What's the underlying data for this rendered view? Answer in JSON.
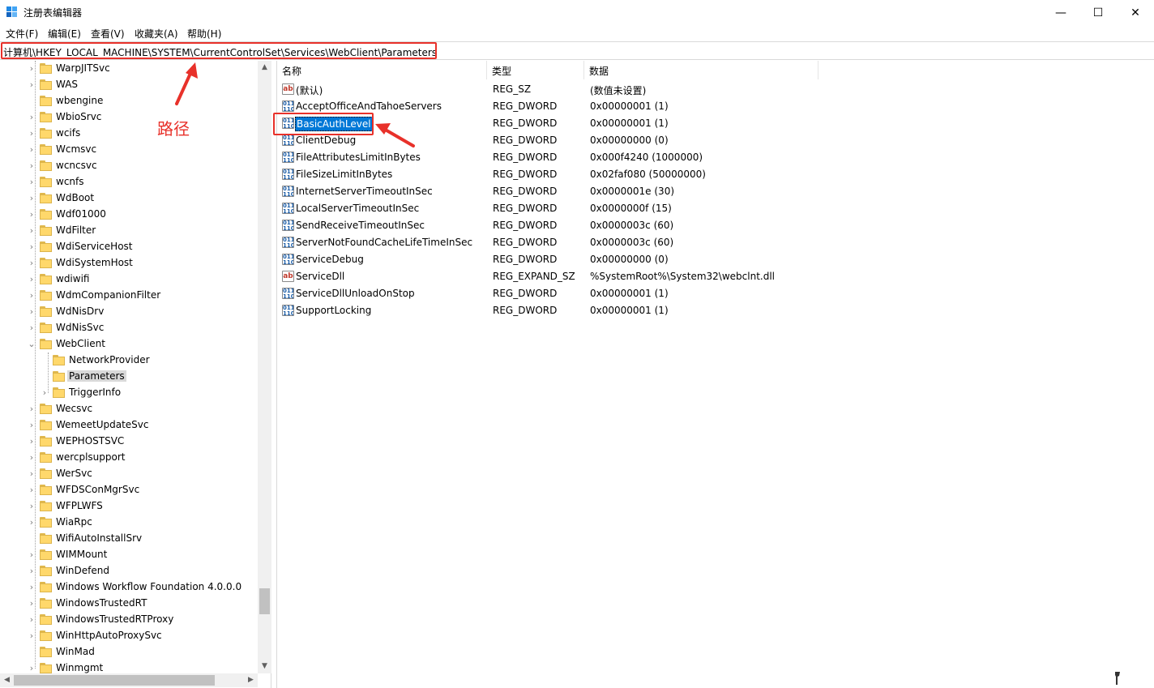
{
  "window": {
    "title": "注册表编辑器",
    "controls": {
      "minimize": "—",
      "maximize": "☐",
      "close": "✕"
    }
  },
  "menu": [
    "文件(F)",
    "编辑(E)",
    "查看(V)",
    "收藏夹(A)",
    "帮助(H)"
  ],
  "address": "计算机\\HKEY_LOCAL_MACHINE\\SYSTEM\\CurrentControlSet\\Services\\WebClient\\Parameters",
  "annotation": {
    "label": "路径"
  },
  "tree": {
    "items": [
      {
        "label": "WarpJITSvc",
        "expandable": true,
        "level": 1
      },
      {
        "label": "WAS",
        "expandable": true,
        "level": 1
      },
      {
        "label": "wbengine",
        "expandable": false,
        "level": 1
      },
      {
        "label": "WbioSrvc",
        "expandable": true,
        "level": 1
      },
      {
        "label": "wcifs",
        "expandable": true,
        "level": 1
      },
      {
        "label": "Wcmsvc",
        "expandable": true,
        "level": 1
      },
      {
        "label": "wcncsvc",
        "expandable": true,
        "level": 1
      },
      {
        "label": "wcnfs",
        "expandable": true,
        "level": 1
      },
      {
        "label": "WdBoot",
        "expandable": true,
        "level": 1
      },
      {
        "label": "Wdf01000",
        "expandable": true,
        "level": 1
      },
      {
        "label": "WdFilter",
        "expandable": true,
        "level": 1
      },
      {
        "label": "WdiServiceHost",
        "expandable": true,
        "level": 1
      },
      {
        "label": "WdiSystemHost",
        "expandable": true,
        "level": 1
      },
      {
        "label": "wdiwifi",
        "expandable": true,
        "level": 1
      },
      {
        "label": "WdmCompanionFilter",
        "expandable": true,
        "level": 1
      },
      {
        "label": "WdNisDrv",
        "expandable": true,
        "level": 1
      },
      {
        "label": "WdNisSvc",
        "expandable": true,
        "level": 1
      },
      {
        "label": "WebClient",
        "expandable": true,
        "expanded": true,
        "level": 1
      },
      {
        "label": "NetworkProvider",
        "expandable": false,
        "level": 2
      },
      {
        "label": "Parameters",
        "expandable": false,
        "level": 2,
        "selected": true
      },
      {
        "label": "TriggerInfo",
        "expandable": true,
        "level": 2
      },
      {
        "label": "Wecsvc",
        "expandable": true,
        "level": 1
      },
      {
        "label": "WemeetUpdateSvc",
        "expandable": true,
        "level": 1
      },
      {
        "label": "WEPHOSTSVC",
        "expandable": true,
        "level": 1
      },
      {
        "label": "wercplsupport",
        "expandable": true,
        "level": 1
      },
      {
        "label": "WerSvc",
        "expandable": true,
        "level": 1
      },
      {
        "label": "WFDSConMgrSvc",
        "expandable": true,
        "level": 1
      },
      {
        "label": "WFPLWFS",
        "expandable": true,
        "level": 1
      },
      {
        "label": "WiaRpc",
        "expandable": true,
        "level": 1
      },
      {
        "label": "WifiAutoInstallSrv",
        "expandable": false,
        "level": 1
      },
      {
        "label": "WIMMount",
        "expandable": true,
        "level": 1
      },
      {
        "label": "WinDefend",
        "expandable": true,
        "level": 1
      },
      {
        "label": "Windows Workflow Foundation 4.0.0.0",
        "expandable": true,
        "level": 1
      },
      {
        "label": "WindowsTrustedRT",
        "expandable": true,
        "level": 1
      },
      {
        "label": "WindowsTrustedRTProxy",
        "expandable": true,
        "level": 1
      },
      {
        "label": "WinHttpAutoProxySvc",
        "expandable": true,
        "level": 1
      },
      {
        "label": "WinMad",
        "expandable": false,
        "level": 1
      },
      {
        "label": "Winmgmt",
        "expandable": true,
        "level": 1
      }
    ]
  },
  "list": {
    "columns": [
      "名称",
      "类型",
      "数据"
    ],
    "rows": [
      {
        "name": "(默认)",
        "type": "REG_SZ",
        "data": "(数值未设置)",
        "icon": "sz"
      },
      {
        "name": "AcceptOfficeAndTahoeServers",
        "type": "REG_DWORD",
        "data": "0x00000001 (1)",
        "icon": "dword"
      },
      {
        "name": "BasicAuthLevel",
        "type": "REG_DWORD",
        "data": "0x00000001 (1)",
        "icon": "dword",
        "selected": true
      },
      {
        "name": "ClientDebug",
        "type": "REG_DWORD",
        "data": "0x00000000 (0)",
        "icon": "dword"
      },
      {
        "name": "FileAttributesLimitInBytes",
        "type": "REG_DWORD",
        "data": "0x000f4240 (1000000)",
        "icon": "dword"
      },
      {
        "name": "FileSizeLimitInBytes",
        "type": "REG_DWORD",
        "data": "0x02faf080 (50000000)",
        "icon": "dword"
      },
      {
        "name": "InternetServerTimeoutInSec",
        "type": "REG_DWORD",
        "data": "0x0000001e (30)",
        "icon": "dword"
      },
      {
        "name": "LocalServerTimeoutInSec",
        "type": "REG_DWORD",
        "data": "0x0000000f (15)",
        "icon": "dword"
      },
      {
        "name": "SendReceiveTimeoutInSec",
        "type": "REG_DWORD",
        "data": "0x0000003c (60)",
        "icon": "dword"
      },
      {
        "name": "ServerNotFoundCacheLifeTimeInSec",
        "type": "REG_DWORD",
        "data": "0x0000003c (60)",
        "icon": "dword"
      },
      {
        "name": "ServiceDebug",
        "type": "REG_DWORD",
        "data": "0x00000000 (0)",
        "icon": "dword"
      },
      {
        "name": "ServiceDll",
        "type": "REG_EXPAND_SZ",
        "data": "%SystemRoot%\\System32\\webclnt.dll",
        "icon": "sz"
      },
      {
        "name": "ServiceDllUnloadOnStop",
        "type": "REG_DWORD",
        "data": "0x00000001 (1)",
        "icon": "dword"
      },
      {
        "name": "SupportLocking",
        "type": "REG_DWORD",
        "data": "0x00000001 (1)",
        "icon": "dword"
      }
    ]
  },
  "colors": {
    "annotation": "#e8312a",
    "selection": "#0078d7",
    "folder": "#ffd86b"
  }
}
